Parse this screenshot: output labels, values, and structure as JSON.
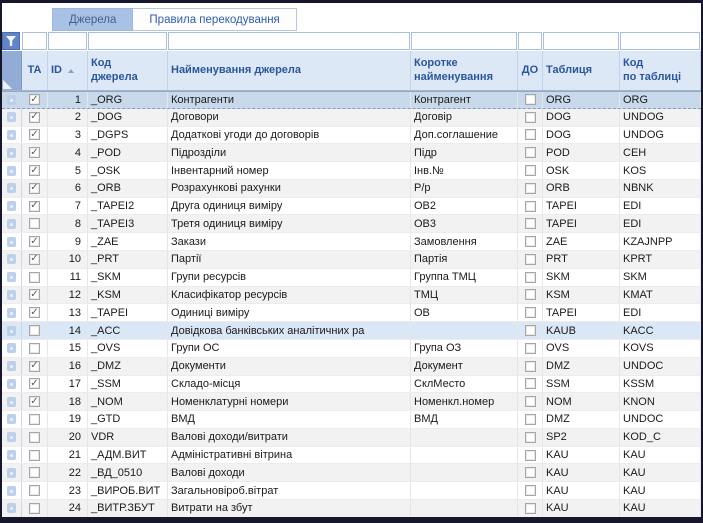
{
  "tabs": [
    {
      "label": "Джерела",
      "active": true
    },
    {
      "label": "Правила перекодування",
      "active": false
    }
  ],
  "icons": {
    "filter": "funnel-icon",
    "sort_ascending": "caret-up-icon",
    "row_marker": "row-marker-icon",
    "select_all_corner": "corner-triangle-icon"
  },
  "colors": {
    "outer_border": "#17172c",
    "active_tab_bg": "#a9c1e5",
    "header_bg": "#dde8f6",
    "header_text": "#2b579a",
    "selected_row_bg": "#c9d9ec",
    "highlighted_row_bg": "#d9e7f7",
    "stripe_row_bg": "#f2f2f2",
    "filter_button_bg": "#6186c7"
  },
  "grid": {
    "columns": {
      "ta": "TA",
      "id": "ID",
      "id_sort": "asc",
      "code": "Код\nджерела",
      "name": "Найменування джерела",
      "short": "Коротке\nнайменування",
      "do": "ДО",
      "table": "Таблиця",
      "table_code": "Код\nпо таблиці"
    },
    "rows": [
      {
        "id": 1,
        "ta": true,
        "code": "_ORG",
        "name": "Контрагенти",
        "short": "Контрагент",
        "do": false,
        "table": "ORG",
        "table_code": "ORG",
        "state": "selected"
      },
      {
        "id": 2,
        "ta": true,
        "code": "_DOG",
        "name": "Договори",
        "short": "Договір",
        "do": false,
        "table": "DOG",
        "table_code": "UNDOG"
      },
      {
        "id": 3,
        "ta": true,
        "code": "_DGPS",
        "name": "Додаткові угоди до договорів",
        "short": "Доп.соглашение",
        "do": false,
        "table": "DOG",
        "table_code": "UNDOG"
      },
      {
        "id": 4,
        "ta": true,
        "code": "_POD",
        "name": "Підрозділи",
        "short": "Підр",
        "do": false,
        "table": "POD",
        "table_code": "CEH"
      },
      {
        "id": 5,
        "ta": true,
        "code": "_OSK",
        "name": "Інвентарний номер",
        "short": "Інв.№",
        "do": false,
        "table": "OSK",
        "table_code": "KOS"
      },
      {
        "id": 6,
        "ta": true,
        "code": "_ORB",
        "name": "Розрахункові рахунки",
        "short": "Р/р",
        "do": false,
        "table": "ORB",
        "table_code": "NBNK"
      },
      {
        "id": 7,
        "ta": true,
        "code": "_TAPEI2",
        "name": "Друга одиниця виміру",
        "short": "ОВ2",
        "do": false,
        "table": "TAPEI",
        "table_code": "EDI"
      },
      {
        "id": 8,
        "ta": false,
        "code": "_TAPEI3",
        "name": "Третя одиниця виміру",
        "short": "ОВ3",
        "do": false,
        "table": "TAPEI",
        "table_code": "EDI"
      },
      {
        "id": 9,
        "ta": true,
        "code": "_ZAE",
        "name": "Закази",
        "short": "Замовлення",
        "do": false,
        "table": "ZAE",
        "table_code": "KZAJNPP"
      },
      {
        "id": 10,
        "ta": true,
        "code": "_PRT",
        "name": "Партії",
        "short": "Партія",
        "do": false,
        "table": "PRT",
        "table_code": "KPRT"
      },
      {
        "id": 11,
        "ta": false,
        "code": "_SKM",
        "name": "Групи ресурсів",
        "short": "Группа ТМЦ",
        "do": false,
        "table": "SKM",
        "table_code": "SKM"
      },
      {
        "id": 12,
        "ta": true,
        "code": "_KSM",
        "name": "Класифікатор ресурсів",
        "short": "ТМЦ",
        "do": false,
        "table": "KSM",
        "table_code": "KMAT"
      },
      {
        "id": 13,
        "ta": true,
        "code": "_TAPEI",
        "name": "Одиниці виміру",
        "short": "ОВ",
        "do": false,
        "table": "TAPEI",
        "table_code": "EDI"
      },
      {
        "id": 14,
        "ta": false,
        "code": "_ACC",
        "name": "Довідкова банківських аналітичних ра",
        "short": "",
        "do": false,
        "table": "KAUB",
        "table_code": "KACC",
        "state": "highlighted"
      },
      {
        "id": 15,
        "ta": false,
        "code": "_OVS",
        "name": "Групи ОС",
        "short": "Група ОЗ",
        "do": false,
        "table": "OVS",
        "table_code": "KOVS"
      },
      {
        "id": 16,
        "ta": true,
        "code": "_DMZ",
        "name": "Документи",
        "short": "Документ",
        "do": false,
        "table": "DMZ",
        "table_code": "UNDOC"
      },
      {
        "id": 17,
        "ta": true,
        "code": "_SSM",
        "name": "Складо-місця",
        "short": "СклМесто",
        "do": false,
        "table": "SSM",
        "table_code": "KSSM"
      },
      {
        "id": 18,
        "ta": true,
        "code": "_NOM",
        "name": "Номенклатурні номери",
        "short": "Номенкл.номер",
        "do": false,
        "table": "NOM",
        "table_code": "KNON"
      },
      {
        "id": 19,
        "ta": false,
        "code": "_GTD",
        "name": "ВМД",
        "short": "ВМД",
        "do": false,
        "table": "DMZ",
        "table_code": "UNDOC"
      },
      {
        "id": 20,
        "ta": false,
        "code": "VDR",
        "name": "Валові доходи/витрати",
        "short": "",
        "do": false,
        "table": "SP2",
        "table_code": "KOD_C"
      },
      {
        "id": 21,
        "ta": false,
        "code": "_АДМ.ВИТ",
        "name": "Адміністративні вітрина",
        "short": "",
        "do": false,
        "table": "KAU",
        "table_code": "KAU"
      },
      {
        "id": 22,
        "ta": false,
        "code": "_ВД_0510",
        "name": "Валові доходи",
        "short": "",
        "do": false,
        "table": "KAU",
        "table_code": "KAU"
      },
      {
        "id": 23,
        "ta": false,
        "code": "_ВИРОБ.ВИТ",
        "name": "Загальновіроб.вітрат",
        "short": "",
        "do": false,
        "table": "KAU",
        "table_code": "KAU"
      },
      {
        "id": 24,
        "ta": false,
        "code": "_ВИТР.ЗБУТ",
        "name": "Витрати на збут",
        "short": "",
        "do": false,
        "table": "KAU",
        "table_code": "KAU"
      }
    ]
  }
}
